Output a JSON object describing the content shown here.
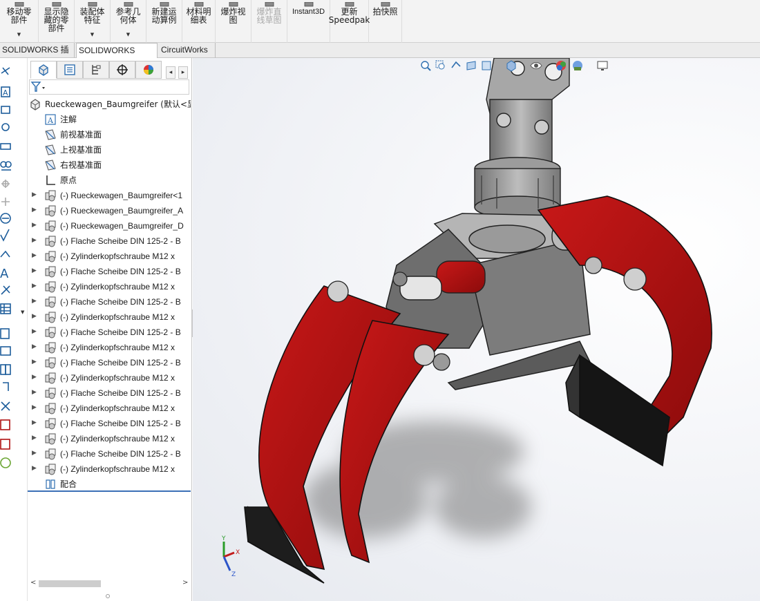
{
  "ribbon": {
    "buttons": [
      {
        "label": "移动零\n部件",
        "caret": true
      },
      {
        "label": "显示隐\n藏的零\n部件",
        "caret": false
      },
      {
        "label": "装配体\n特征",
        "caret": true
      },
      {
        "label": "参考几\n何体",
        "caret": true
      },
      {
        "label": "新建运\n动算例",
        "caret": false
      },
      {
        "label": "材料明\n细表",
        "caret": false
      },
      {
        "label": "爆炸视\n图",
        "caret": false
      },
      {
        "label": "爆炸直\n线草图",
        "caret": false,
        "disabled": true
      },
      {
        "label": "Instant3D",
        "caret": false
      },
      {
        "label": "更新\nSpeedpak",
        "caret": false
      },
      {
        "label": "拍快照",
        "caret": false
      }
    ]
  },
  "tabs": [
    {
      "label": "SOLIDWORKS 插件"
    },
    {
      "label": "SOLIDWORKS MBD"
    },
    {
      "label": "CircuitWorks"
    }
  ],
  "feature_manager": {
    "tab_icons": [
      "assembly-tab-icon",
      "property-manager-icon",
      "configuration-manager-icon",
      "dimxpert-icon",
      "display-manager-icon"
    ],
    "nav_prev": "◂",
    "nav_next": "▸",
    "filter_icon": "filter-icon",
    "tree": [
      {
        "label": "Rueckewagen_Baumgreifer  (默认<显",
        "icon": "assembly-icon",
        "expandable": false,
        "level": 0
      },
      {
        "label": "注解",
        "icon": "annotation-icon",
        "expandable": false,
        "level": 1
      },
      {
        "label": "前视基准面",
        "icon": "plane-icon",
        "expandable": false,
        "level": 1
      },
      {
        "label": "上视基准面",
        "icon": "plane-icon",
        "expandable": false,
        "level": 1
      },
      {
        "label": "右视基准面",
        "icon": "plane-icon",
        "expandable": false,
        "level": 1
      },
      {
        "label": "原点",
        "icon": "origin-icon",
        "expandable": false,
        "level": 1
      },
      {
        "label": "(-) Rueckewagen_Baumgreifer<1",
        "icon": "subassembly-icon",
        "expandable": true,
        "level": 1
      },
      {
        "label": "(-) Rueckewagen_Baumgreifer_A",
        "icon": "subassembly-icon",
        "expandable": true,
        "level": 1
      },
      {
        "label": "(-) Rueckewagen_Baumgreifer_D",
        "icon": "subassembly-icon",
        "expandable": true,
        "level": 1
      },
      {
        "label": "(-) Flache Scheibe DIN 125-2 - B",
        "icon": "subassembly-icon",
        "expandable": true,
        "level": 1
      },
      {
        "label": "(-) Zylinderkopfschraube M12 x",
        "icon": "subassembly-icon",
        "expandable": true,
        "level": 1
      },
      {
        "label": "(-) Flache Scheibe DIN 125-2 - B",
        "icon": "subassembly-icon",
        "expandable": true,
        "level": 1
      },
      {
        "label": "(-) Zylinderkopfschraube M12 x",
        "icon": "subassembly-icon",
        "expandable": true,
        "level": 1
      },
      {
        "label": "(-) Flache Scheibe DIN 125-2 - B",
        "icon": "subassembly-icon",
        "expandable": true,
        "level": 1
      },
      {
        "label": "(-) Zylinderkopfschraube M12 x",
        "icon": "subassembly-icon",
        "expandable": true,
        "level": 1
      },
      {
        "label": "(-) Flache Scheibe DIN 125-2 - B",
        "icon": "subassembly-icon",
        "expandable": true,
        "level": 1
      },
      {
        "label": "(-) Zylinderkopfschraube M12 x",
        "icon": "subassembly-icon",
        "expandable": true,
        "level": 1
      },
      {
        "label": "(-) Flache Scheibe DIN 125-2 - B",
        "icon": "subassembly-icon",
        "expandable": true,
        "level": 1
      },
      {
        "label": "(-) Zylinderkopfschraube M12 x",
        "icon": "subassembly-icon",
        "expandable": true,
        "level": 1
      },
      {
        "label": "(-) Flache Scheibe DIN 125-2 - B",
        "icon": "subassembly-icon",
        "expandable": true,
        "level": 1
      },
      {
        "label": "(-) Zylinderkopfschraube M12 x",
        "icon": "subassembly-icon",
        "expandable": true,
        "level": 1
      },
      {
        "label": "(-) Flache Scheibe DIN 125-2 - B",
        "icon": "subassembly-icon",
        "expandable": true,
        "level": 1
      },
      {
        "label": "(-) Zylinderkopfschraube M12 x",
        "icon": "subassembly-icon",
        "expandable": true,
        "level": 1
      },
      {
        "label": "(-) Flache Scheibe DIN 125-2 - B",
        "icon": "subassembly-icon",
        "expandable": true,
        "level": 1
      },
      {
        "label": "(-) Zylinderkopfschraube M12 x",
        "icon": "subassembly-icon",
        "expandable": true,
        "level": 1
      },
      {
        "label": "配合",
        "icon": "mates-icon",
        "expandable": false,
        "level": 1
      }
    ],
    "scroll_left": "<",
    "scroll_right": ">"
  },
  "view_toolbar": {
    "icons": [
      "zoom-to-fit-icon",
      "zoom-to-area-icon",
      "previous-view-icon",
      "section-view-icon",
      "view-orientation-icon",
      "display-style-icon",
      "hide-show-items-icon",
      "edit-appearance-icon",
      "apply-scene-icon",
      "view-settings-icon"
    ]
  },
  "triad": {
    "x_label": "X",
    "y_label": "Y",
    "z_label": "Z"
  },
  "colors": {
    "accent_red": "#b01010",
    "steel": "#8a8a8a",
    "tree_underline": "#3a6fb6",
    "active_tab": "#ffffff"
  }
}
